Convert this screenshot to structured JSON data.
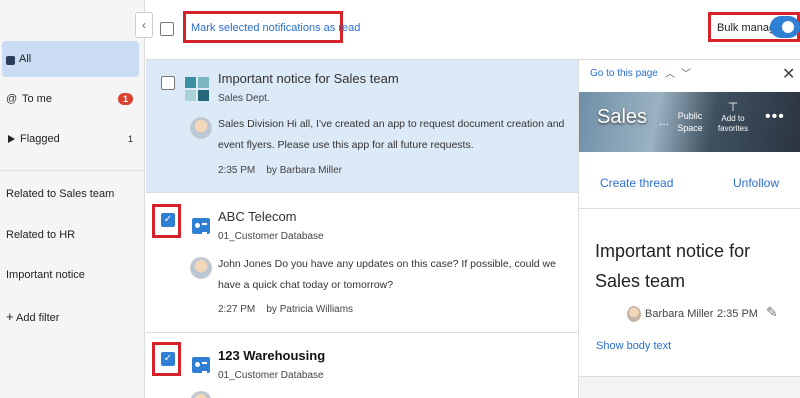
{
  "sidebar": {
    "items": [
      {
        "label": "All"
      },
      {
        "label": "To me",
        "badge": "1"
      },
      {
        "label": "Flagged",
        "count": "1"
      }
    ],
    "filters": [
      {
        "label": "Related to Sales team"
      },
      {
        "label": "Related to HR"
      },
      {
        "label": "Important notice"
      }
    ],
    "add_filter": "Add filter"
  },
  "toolbar": {
    "mark_read": "Mark selected notifications as read",
    "bulk_manage": "Bulk manage",
    "bulk_manage_on": true
  },
  "notifications": [
    {
      "title": "Important notice for Sales team",
      "subtitle": "Sales Dept.",
      "body": "Sales Division Hi all, I've created an app to request document creation and event flyers. Please use this app for all future requests.",
      "time": "2:35 PM",
      "author": "by Barbara Miller",
      "selected_row": true,
      "checked": false
    },
    {
      "title": "ABC Telecom",
      "subtitle": "01_Customer Database",
      "body": "John Jones Do you have any updates on this case? If possible, could we have a quick chat today or tomorrow?",
      "time": "2:27 PM",
      "author": "by Patricia Williams",
      "checked": true
    },
    {
      "title": "123 Warehousing",
      "subtitle": "01_Customer Database",
      "checked": true,
      "unread": true
    }
  ],
  "panel": {
    "goto": "Go to this page",
    "space_name": "Sales",
    "space_ellipsis": "...",
    "public_label": "Public Space",
    "add_favorites": "Add to favorites",
    "create_thread": "Create thread",
    "unfollow": "Unfollow",
    "detail_title": "Important notice for Sales team",
    "author": "Barbara Miller",
    "time": "2:35 PM",
    "show_body": "Show body text"
  },
  "colors": {
    "accent": "#2f80d5",
    "link": "#2a6fd1",
    "highlight_box": "#d8222a",
    "badge": "#d9412f",
    "selected_row": "#dce9f7",
    "sidebar_active": "#c9dcf3"
  }
}
